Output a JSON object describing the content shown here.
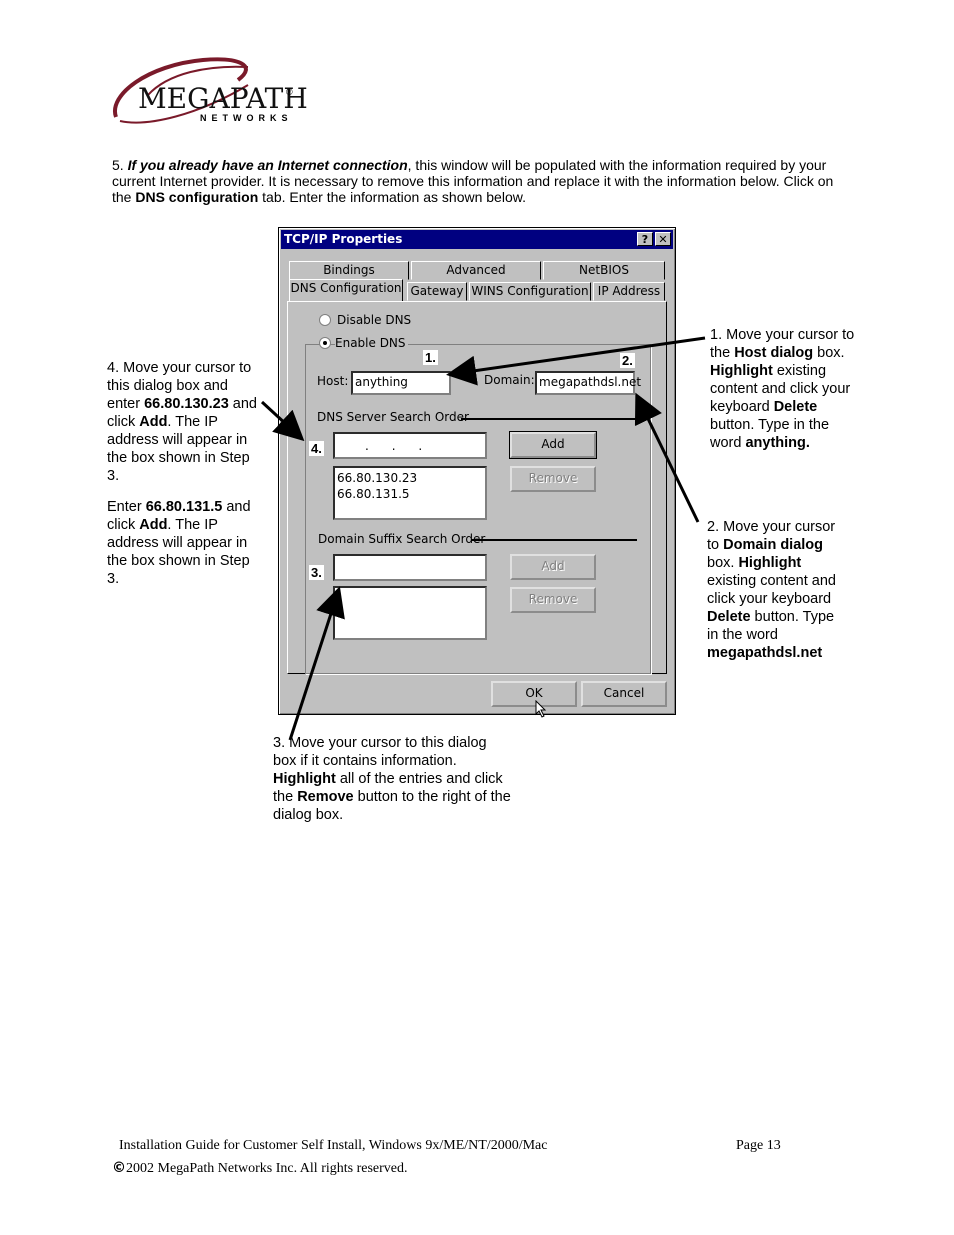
{
  "logo": {
    "name": "MEGAPATH",
    "sub": "NETWORKS",
    "trademark": "®"
  },
  "intro": {
    "num": "5. ",
    "em": "If you already have an Internet connection",
    "t1": ", this window will be populated with the information required by your current Internet provider. It is necessary to remove this information and replace it with the information below. Click on the ",
    "b1": "DNS configuration",
    "t2": " tab. Enter the information as shown below."
  },
  "dialog": {
    "title": "TCP/IP Properties",
    "help_icon": "?",
    "close_icon": "✕",
    "tabs_row1": [
      "Bindings",
      "Advanced",
      "NetBIOS"
    ],
    "tabs_row2": [
      "DNS Configuration",
      "Gateway",
      "WINS Configuration",
      "IP Address"
    ],
    "disable_dns": "Disable DNS",
    "enable_dns": "Enable DNS",
    "host_label": "Host:",
    "host_value": "anything",
    "domain_label": "Domain:",
    "domain_value": "megapathdsl.net",
    "dns_search_label": "DNS Server Search Order",
    "ip_dots": ".      .      .",
    "dns_list": [
      "66.80.130.23",
      "66.80.131.5"
    ],
    "add": "Add",
    "remove": "Remove",
    "suffix_label": "Domain Suffix Search Order",
    "ok": "OK",
    "cancel": "Cancel"
  },
  "markers": {
    "m1": "1.",
    "m2": "2.",
    "m3": "3.",
    "m4": "4."
  },
  "note1": {
    "a": "1.  Move your cursor to the ",
    "b": "Host dialog",
    "c": " box.  ",
    "d": "Highlight",
    "e": " existing content and click your keyboard ",
    "f": "Delete",
    "g": " button.  Type in the word ",
    "h": "anything."
  },
  "note2": {
    "a": "2.  Move your cursor to ",
    "b": "Domain dialog",
    "c": " box. ",
    "d": "Highlight",
    "e": " existing content and click your keyboard ",
    "f": "Delete",
    "g": " button. Type in the word ",
    "h": "megapathdsl.net"
  },
  "note3": {
    "a": "3.  Move your cursor to this dialog box if it contains information. ",
    "b": "Highlight",
    "c": " all of the entries and click the ",
    "d": "Remove",
    "e": " button to the right of the dialog box."
  },
  "note4": {
    "a": "4. Move your cursor to this dialog box and enter ",
    "b": "66.80.130.23",
    "c": " and click ",
    "d": "Add",
    "e": ".  The IP address will appear in the box shown in Step 3."
  },
  "note4b": {
    "a": "Enter ",
    "b": "66.80.131.5",
    "c": " and click ",
    "d": "Add",
    "e": ".  The IP address will appear in the box shown in Step 3."
  },
  "footer": {
    "guide": "Installation Guide for Customer Self Install, Windows 9x/ME/NT/2000/Mac",
    "page": "Page 13",
    "copy_symbol": "©",
    "copyright": "2002 MegaPath Networks Inc. All rights reserved."
  }
}
